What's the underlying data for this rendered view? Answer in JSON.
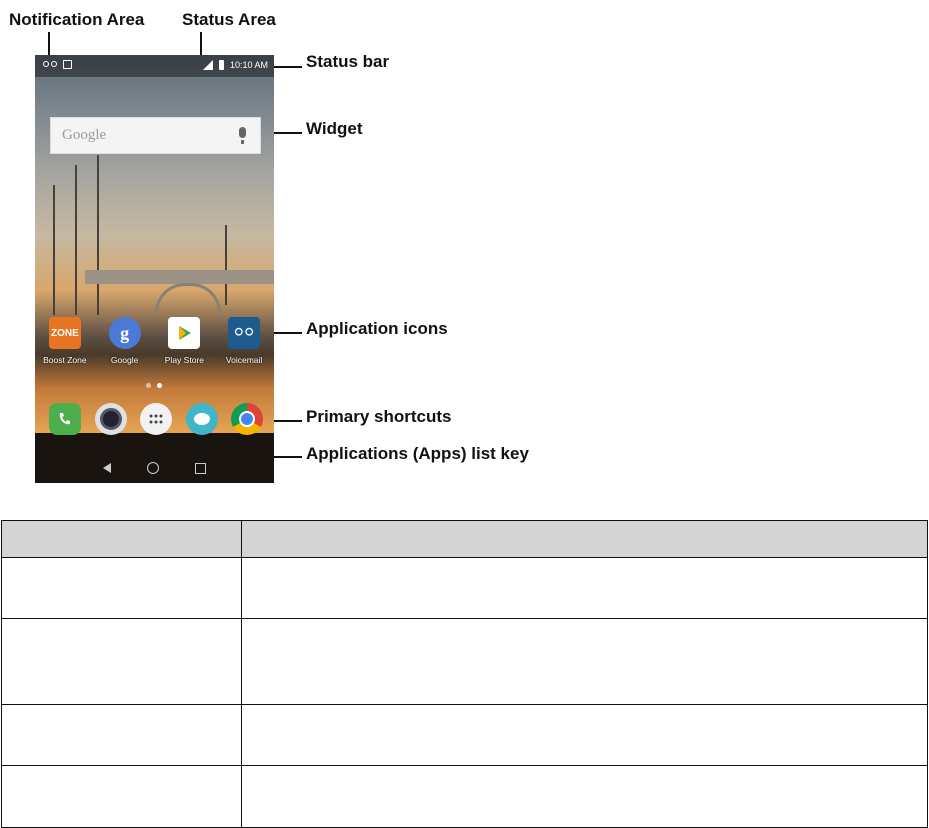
{
  "callouts": {
    "notification_area": "Notification Area",
    "status_area": "Status Area",
    "status_bar": "Status bar",
    "widget": "Widget",
    "application_icons": "Application icons",
    "primary_shortcuts": "Primary shortcuts",
    "apps_list_key": "Applications (Apps) list key"
  },
  "phone": {
    "clock": "10:10 AM",
    "search_placeholder": "Google",
    "apps": [
      {
        "label": "Boost Zone",
        "tile_text": "ZONE",
        "color": "#e87423"
      },
      {
        "label": "Google",
        "tile_text": "g",
        "color": "#4a7ad6"
      },
      {
        "label": "Play Store",
        "tile_text": "",
        "color": "#ffffff"
      },
      {
        "label": "Voicemail",
        "tile_text": "oo",
        "color": "#1e5b8e"
      }
    ],
    "shortcut_colors": {
      "phone": "#4cae4c",
      "camera": "#e0e0e0",
      "apps": "#f2f2f2",
      "messaging": "#3fb6c9",
      "chrome": "#db4437"
    }
  },
  "table": {
    "rows": [
      {
        "label": "",
        "description": ""
      },
      {
        "label": "",
        "description": ""
      },
      {
        "label": "",
        "description": ""
      },
      {
        "label": "",
        "description": ""
      }
    ]
  }
}
